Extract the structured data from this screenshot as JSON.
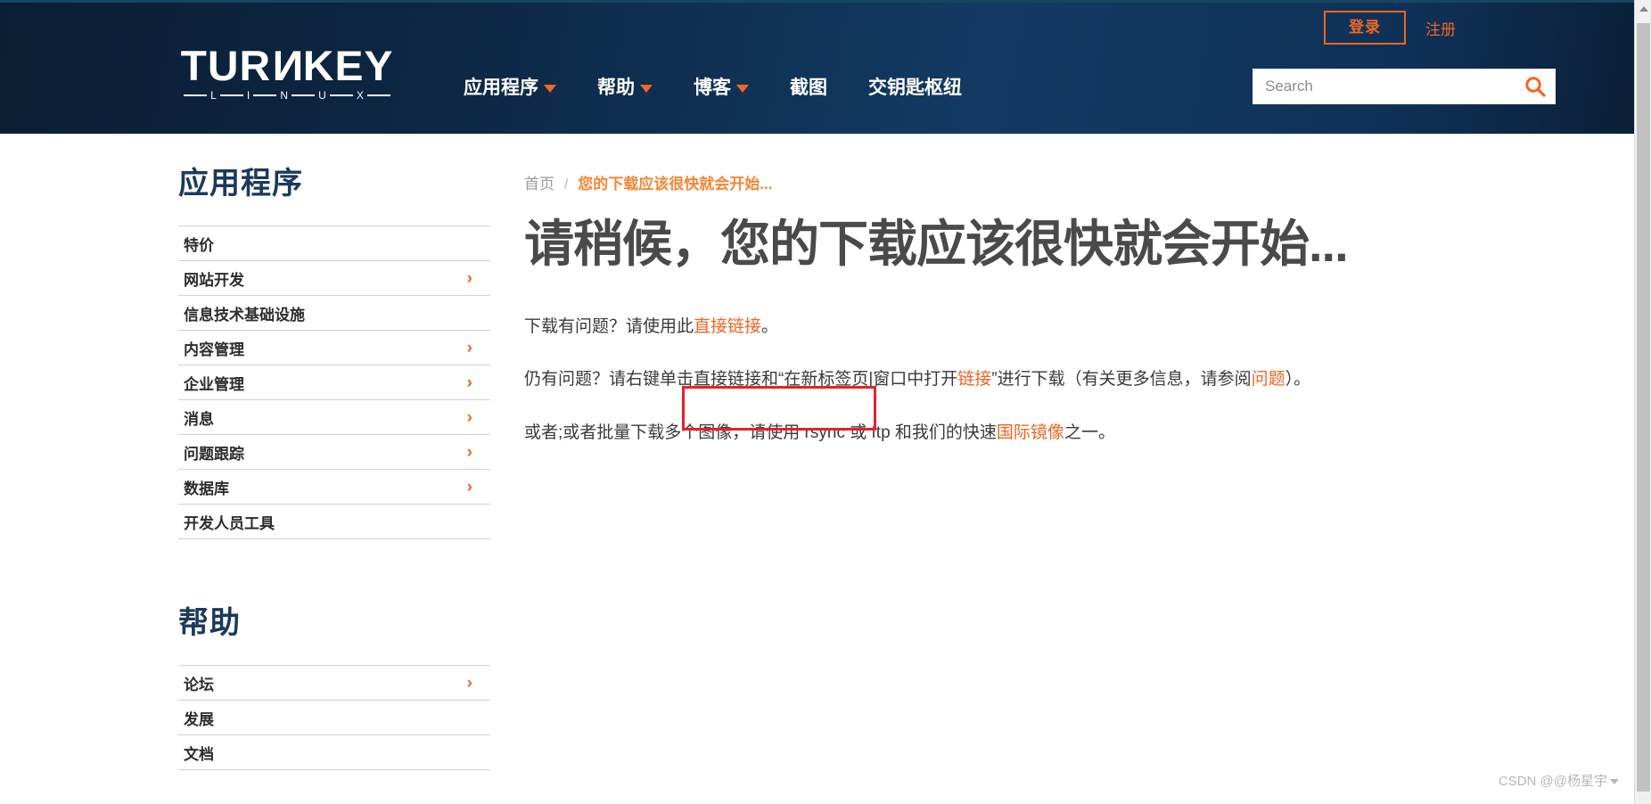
{
  "header": {
    "auth": {
      "login_label": "登录",
      "register_label": "注册"
    },
    "logo": {
      "word_part1": "TUR",
      "word_rev": "N",
      "word_part2": "KEY",
      "sub_letters": [
        "L",
        "I",
        "N",
        "U",
        "X"
      ]
    },
    "nav": [
      {
        "label": "应用程序",
        "has_dropdown": true
      },
      {
        "label": "帮助",
        "has_dropdown": true
      },
      {
        "label": "博客",
        "has_dropdown": true
      },
      {
        "label": "截图",
        "has_dropdown": false
      },
      {
        "label": "交钥匙枢纽",
        "has_dropdown": false
      }
    ],
    "search": {
      "placeholder": "Search",
      "value": "",
      "icon": "search-icon"
    },
    "colors": {
      "accent": "#f26522",
      "bar_dark": "#0d2744",
      "bar_light": "#123a63"
    }
  },
  "sidebar": {
    "sections": [
      {
        "title": "应用程序",
        "items": [
          {
            "label": "特价",
            "has_chevron": false
          },
          {
            "label": "网站开发",
            "has_chevron": true
          },
          {
            "label": "信息技术基础设施",
            "has_chevron": false
          },
          {
            "label": "内容管理",
            "has_chevron": true
          },
          {
            "label": "企业管理",
            "has_chevron": true
          },
          {
            "label": "消息",
            "has_chevron": true
          },
          {
            "label": "问题跟踪",
            "has_chevron": true
          },
          {
            "label": "数据库",
            "has_chevron": true
          },
          {
            "label": "开发人员工具",
            "has_chevron": false
          }
        ]
      },
      {
        "title": "帮助",
        "items": [
          {
            "label": "论坛",
            "has_chevron": true
          },
          {
            "label": "发展",
            "has_chevron": false
          },
          {
            "label": "文档",
            "has_chevron": false
          }
        ]
      }
    ],
    "chevron_glyph": "›"
  },
  "main": {
    "breadcrumb": {
      "home": "首页",
      "separator": "/",
      "current": "您的下载应该很快就会开始..."
    },
    "title": "请稍候，您的下载应该很快就会开始...",
    "paragraphs": {
      "p1": {
        "before": "下载有问题？请使用此",
        "link": "直接链接",
        "after": "。"
      },
      "p2": {
        "before": "仍有问题？请右键单击直接链接和“在新标签页|窗口中打开",
        "link1": "链接",
        "middle": "”进行下载（有关更多信息，请参阅",
        "link2": "问题",
        "after": "）。"
      },
      "p3": {
        "before": "或者;或者批量下载多个图像，请使用 rsync 或 ftp 和我们的快速",
        "link": "国际镜像",
        "after": "之一。"
      }
    },
    "annotation": {
      "shape": "rectangle",
      "color": "#e8202a"
    }
  },
  "watermark": {
    "text": "CSDN @@杨星宇"
  }
}
